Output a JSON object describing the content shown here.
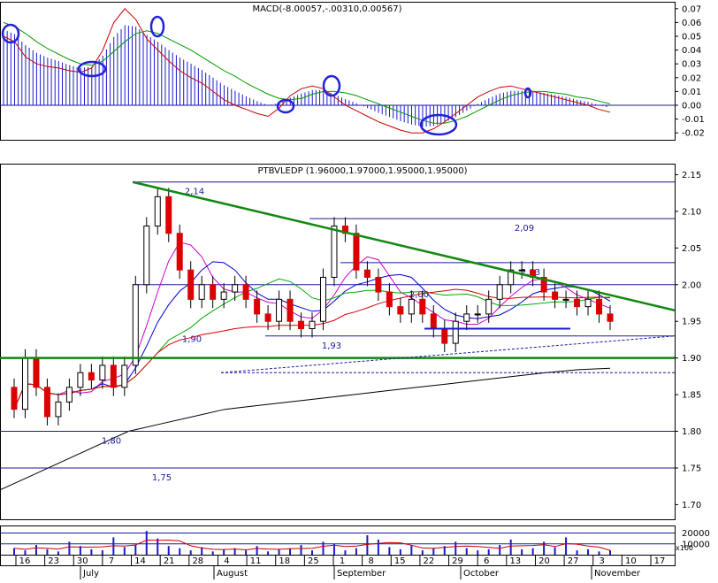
{
  "chart_data": [
    {
      "type": "line",
      "pane": "macd",
      "title": "MACD(-8.00057,-.00310,0.00567)",
      "ylim": [
        -0.025,
        0.075
      ],
      "yticks": [
        -0.02,
        -0.01,
        0.0,
        0.01,
        0.02,
        0.03,
        0.04,
        0.05,
        0.06,
        0.07
      ],
      "yticklabels": [
        "-0.02",
        "-0.01",
        "0.00",
        "0.01",
        "0.02",
        "0.03",
        "0.04",
        "0.05",
        "0.06",
        "0.07"
      ],
      "series": [
        {
          "name": "MACD",
          "color": "#cc0000",
          "values": [
            0.05,
            0.046,
            0.035,
            0.03,
            0.028,
            0.027,
            0.025,
            0.024,
            0.027,
            0.04,
            0.06,
            0.07,
            0.062,
            0.048,
            0.04,
            0.032,
            0.025,
            0.02,
            0.016,
            0.01,
            0.004,
            0.0,
            -0.003,
            -0.006,
            -0.008,
            -0.002,
            0.007,
            0.012,
            0.014,
            0.012,
            0.006,
            0.0,
            -0.004,
            -0.008,
            -0.012,
            -0.015,
            -0.018,
            -0.02,
            -0.02,
            -0.017,
            -0.012,
            -0.006,
            0.0,
            0.006,
            0.01,
            0.013,
            0.014,
            0.012,
            0.01,
            0.008,
            0.006,
            0.004,
            0.002,
            0.0,
            -0.003,
            -0.005
          ]
        },
        {
          "name": "Signal",
          "color": "#009900",
          "values": [
            0.06,
            0.057,
            0.052,
            0.046,
            0.041,
            0.037,
            0.033,
            0.03,
            0.029,
            0.032,
            0.039,
            0.046,
            0.052,
            0.054,
            0.052,
            0.048,
            0.044,
            0.04,
            0.035,
            0.03,
            0.025,
            0.021,
            0.016,
            0.012,
            0.008,
            0.005,
            0.004,
            0.005,
            0.008,
            0.01,
            0.01,
            0.009,
            0.007,
            0.004,
            0.001,
            -0.002,
            -0.005,
            -0.008,
            -0.011,
            -0.013,
            -0.013,
            -0.011,
            -0.008,
            -0.004,
            0.0,
            0.004,
            0.007,
            0.009,
            0.01,
            0.01,
            0.009,
            0.008,
            0.006,
            0.005,
            0.003,
            0.001
          ]
        }
      ],
      "histogram_color": "#1a1acc",
      "annotation_color": "#2222dd"
    },
    {
      "type": "candlestick",
      "pane": "price",
      "title": "PTBVLEDP (1.96000,1.97000,1.95000,1.95000)",
      "ylim": [
        1.68,
        2.165
      ],
      "yticks": [
        1.7,
        1.75,
        1.8,
        1.85,
        1.9,
        1.95,
        2.0,
        2.05,
        2.1,
        2.15
      ],
      "yticklabels": [
        "1.70",
        "1.75",
        "1.80",
        "1.85",
        "1.90",
        "1.95",
        "2.00",
        "2.05",
        "2.10",
        "2.15"
      ],
      "xticklabels": [
        "16",
        "23",
        "30",
        "7",
        "14",
        "21",
        "28",
        "4",
        "11",
        "18",
        "25",
        "1",
        "8",
        "15",
        "22",
        "29",
        "6",
        "13",
        "20",
        "27",
        "3",
        "10",
        "17"
      ],
      "months": [
        "July",
        "August",
        "September",
        "October",
        "November"
      ],
      "up_color": "#ffffff",
      "down_color": "#dd0000",
      "close": [
        1.83,
        1.9,
        1.86,
        1.82,
        1.84,
        1.86,
        1.88,
        1.87,
        1.89,
        1.86,
        1.89,
        2.0,
        2.08,
        2.12,
        2.07,
        2.02,
        1.98,
        2.0,
        1.98,
        1.99,
        2.0,
        1.98,
        1.96,
        1.95,
        1.98,
        1.95,
        1.94,
        1.95,
        2.01,
        2.08,
        2.07,
        2.02,
        2.01,
        1.99,
        1.97,
        1.96,
        1.98,
        1.96,
        1.94,
        1.92,
        1.95,
        1.96,
        1.96,
        1.98,
        2.0,
        2.02,
        2.02,
        2.01,
        1.99,
        1.98,
        1.98,
        1.97,
        1.98,
        1.96,
        1.95
      ],
      "open": [
        1.86,
        1.83,
        1.9,
        1.86,
        1.82,
        1.84,
        1.86,
        1.88,
        1.87,
        1.89,
        1.86,
        1.89,
        2.0,
        2.08,
        2.12,
        2.07,
        2.02,
        1.98,
        2.0,
        1.98,
        1.99,
        2.0,
        1.98,
        1.96,
        1.95,
        1.98,
        1.95,
        1.94,
        1.95,
        2.01,
        2.08,
        2.07,
        2.02,
        2.01,
        1.99,
        1.97,
        1.96,
        1.98,
        1.96,
        1.94,
        1.92,
        1.95,
        1.96,
        1.96,
        1.98,
        2.0,
        2.02,
        2.02,
        2.01,
        1.99,
        1.98,
        1.98,
        1.97,
        1.98,
        1.96
      ],
      "overlays": [
        {
          "kind": "ma",
          "color": "#cc00cc",
          "period": 5
        },
        {
          "kind": "ma",
          "color": "#0000cc",
          "period": 8
        },
        {
          "kind": "ma",
          "color": "#00aa00",
          "period": 14
        },
        {
          "kind": "ma",
          "color": "#dd0000",
          "period": 30
        }
      ],
      "long_ma": {
        "color": "#000000",
        "values": [
          1.72,
          1.74,
          1.76,
          1.78,
          1.8,
          1.81,
          1.82,
          1.83,
          1.835,
          1.84,
          1.845,
          1.85,
          1.855,
          1.86,
          1.865,
          1.87,
          1.875,
          1.88,
          1.884,
          1.886
        ]
      },
      "level_labels": [
        "2,14",
        "2,09",
        "2,03",
        "2,00",
        "1,93",
        "1,90",
        "1,80",
        "1,75"
      ],
      "levels": [
        2.14,
        2.09,
        2.03,
        2.0,
        1.93,
        1.9,
        1.8,
        1.75
      ],
      "trendline": {
        "color": "#118811",
        "from": 2.14,
        "to": 1.965
      },
      "support_line": {
        "color": "#118811",
        "value": 1.9
      }
    },
    {
      "type": "bar",
      "pane": "volume",
      "ylim": [
        0,
        27000
      ],
      "yticks": [
        10000,
        20000
      ],
      "yticklabels": [
        "10000",
        "20000"
      ],
      "unit_label": "x100",
      "color": "#1a1acc",
      "values": [
        6000,
        4000,
        9000,
        5000,
        3000,
        12000,
        8000,
        5000,
        4000,
        16000,
        7000,
        9000,
        22000,
        15000,
        8000,
        6000,
        4000,
        7000,
        3000,
        5000,
        6000,
        4000,
        8000,
        3000,
        5000,
        6000,
        9000,
        4000,
        12000,
        10000,
        4000,
        6000,
        18000,
        14000,
        7000,
        5000,
        9000,
        4000,
        6000,
        8000,
        12000,
        6000,
        4000,
        5000,
        9000,
        14000,
        5000,
        6000,
        12000,
        7000,
        16000,
        4000,
        5000,
        3000,
        4000
      ]
    }
  ]
}
